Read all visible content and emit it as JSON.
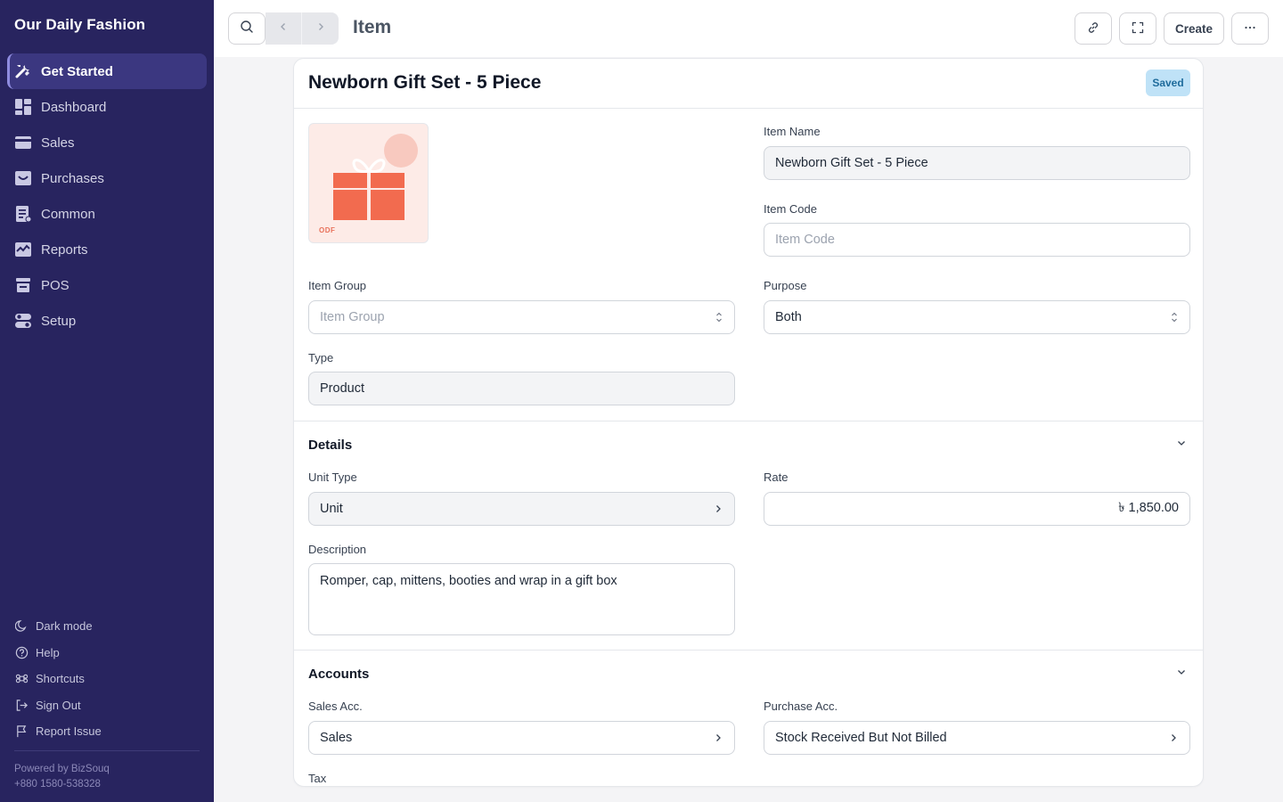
{
  "app": {
    "brand": "Our Daily Fashion",
    "powered_by": "Powered by BizSouq",
    "phone": "+880 1580-538328"
  },
  "sidebar": {
    "items": [
      {
        "label": "Get Started",
        "icon": "tools-icon",
        "active": true
      },
      {
        "label": "Dashboard",
        "icon": "dashboard-icon"
      },
      {
        "label": "Sales",
        "icon": "card-icon"
      },
      {
        "label": "Purchases",
        "icon": "inbox-icon"
      },
      {
        "label": "Common",
        "icon": "document-icon"
      },
      {
        "label": "Reports",
        "icon": "chart-icon"
      },
      {
        "label": "POS",
        "icon": "store-icon"
      },
      {
        "label": "Setup",
        "icon": "toggle-icon"
      }
    ],
    "bottom": [
      {
        "label": "Dark mode",
        "icon": "moon-icon"
      },
      {
        "label": "Help",
        "icon": "help-icon"
      },
      {
        "label": "Shortcuts",
        "icon": "command-icon"
      },
      {
        "label": "Sign Out",
        "icon": "sign-out-icon"
      },
      {
        "label": "Report Issue",
        "icon": "flag-icon"
      }
    ]
  },
  "topbar": {
    "title": "Item",
    "create_label": "Create"
  },
  "form": {
    "doc_title": "Newborn Gift Set - 5 Piece",
    "status": "Saved",
    "image_tag": "ODF",
    "item_name": {
      "label": "Item Name",
      "value": "Newborn Gift Set - 5 Piece"
    },
    "item_code": {
      "label": "Item Code",
      "placeholder": "Item Code"
    },
    "item_group": {
      "label": "Item Group",
      "placeholder": "Item Group"
    },
    "purpose": {
      "label": "Purpose",
      "value": "Both"
    },
    "type": {
      "label": "Type",
      "value": "Product"
    },
    "details": {
      "title": "Details",
      "unit_type": {
        "label": "Unit Type",
        "value": "Unit"
      },
      "rate": {
        "label": "Rate",
        "value": "৳ 1,850.00"
      },
      "description": {
        "label": "Description",
        "value": "Romper, cap, mittens, booties and wrap in a gift box"
      }
    },
    "accounts": {
      "title": "Accounts",
      "sales_acc": {
        "label": "Sales Acc.",
        "value": "Sales"
      },
      "purchase_acc": {
        "label": "Purchase Acc.",
        "value": "Stock Received But Not Billed"
      },
      "tax": {
        "label": "Tax"
      }
    }
  },
  "colors": {
    "sidebar_bg": "#28245f",
    "badge_bg": "#bfe2f7",
    "gift_red": "#f26b4f"
  }
}
